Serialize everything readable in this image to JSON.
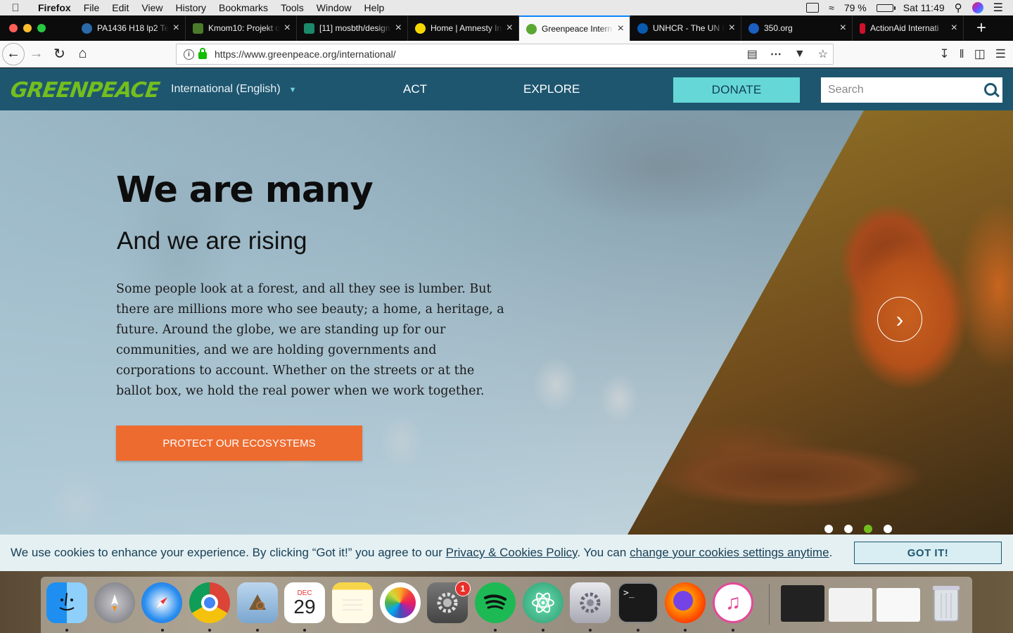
{
  "menubar": {
    "app": "Firefox",
    "items": [
      "File",
      "Edit",
      "View",
      "History",
      "Bookmarks",
      "Tools",
      "Window",
      "Help"
    ],
    "battery": "79 %",
    "clock": "Sat 11:49"
  },
  "tabs": [
    {
      "title": "PA1436 H18 lp2 Te",
      "favicon_color": "#2a6aa8"
    },
    {
      "title": "Kmom10: Projekt o",
      "favicon_color": "#4a7a2a"
    },
    {
      "title": "[11] mosbth/design",
      "favicon_color": "#1a8a6a"
    },
    {
      "title": "Home | Amnesty In",
      "favicon_color": "#f5d800"
    },
    {
      "title": "Greenpeace Intern",
      "favicon_color": "#5aa832",
      "active": true
    },
    {
      "title": "UNHCR - The UN R",
      "favicon_color": "#0a5ab0"
    },
    {
      "title": "350.org",
      "favicon_color": "#1c5fc0"
    },
    {
      "title": "ActionAid Internati",
      "favicon_color": "#d0102a"
    }
  ],
  "addressbar": {
    "url": "https://www.greenpeace.org/international/"
  },
  "site": {
    "logo": "GREENPEACE",
    "language": "International (English)",
    "nav": {
      "act": "ACT",
      "explore": "EXPLORE"
    },
    "donate": "DONATE",
    "search_placeholder": "Search"
  },
  "hero": {
    "title": "We are many",
    "subtitle": "And we are rising",
    "body": "Some people look at a forest, and all they see is lumber. But there are millions more who see beauty; a home, a heritage, a future. Around the globe, we are standing up for our communities, and we are holding governments and corporations to account. Whether on the streets or at the ballot box, we hold the real power when we work together.",
    "cta": "PROTECT OUR ECOSYSTEMS",
    "slides_total": 4,
    "active_slide": 3
  },
  "cookie": {
    "text_before": "We use cookies to enhance your experience. By clicking “Got it!” you agree to our ",
    "link1": "Privacy & Cookies Policy",
    "text_middle": ". You can ",
    "link2": "change your cookies settings anytime",
    "text_after": ".",
    "button": "GOT IT!"
  },
  "dock": {
    "apps": [
      "Finder",
      "Launchpad",
      "Safari",
      "Chrome",
      "Mail",
      "Calendar",
      "Notes",
      "Photos",
      "System Preferences",
      "Spotify",
      "Atom",
      "Utility",
      "Terminal",
      "Firefox",
      "iTunes"
    ],
    "calendar_month": "DEC",
    "calendar_day": "29",
    "sysprefs_badge": "1",
    "terminal_prompt": ">_"
  },
  "colors": {
    "gp_nav": "#1e5670",
    "gp_green": "#73be1e",
    "donate": "#66d7d7",
    "cta": "#ee6b2f"
  }
}
